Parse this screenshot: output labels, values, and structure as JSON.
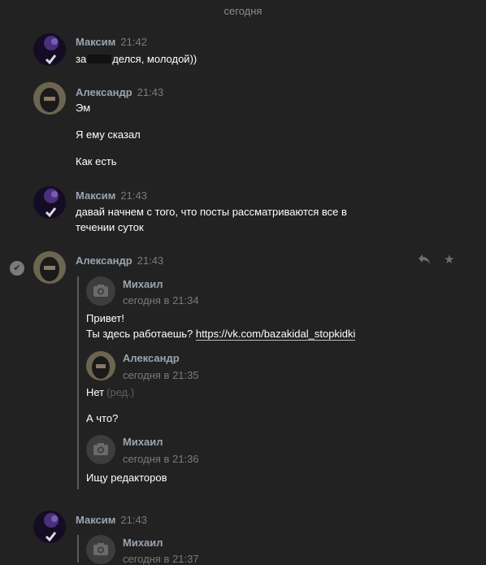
{
  "date_separator": "сегодня",
  "messages": [
    {
      "author": "Максим",
      "time": "21:42",
      "lines": [
        "за",
        "делся, молодой))"
      ]
    },
    {
      "author": "Александр",
      "time": "21:43",
      "lines": [
        "Эм",
        "Я ему сказал",
        "Как есть"
      ]
    },
    {
      "author": "Максим",
      "time": "21:43",
      "lines": [
        "давай начнем с того, что посты рассматриваются все в",
        "течении суток"
      ]
    },
    {
      "author": "Александр",
      "time": "21:43",
      "forwarded": [
        {
          "author": "Михаил",
          "date": "сегодня в 21:34",
          "lines": [
            "Привет!",
            "Ты здесь работаешь?"
          ],
          "link": "https://vk.com/bazakidal_stopkidki"
        },
        {
          "author": "Александр",
          "date": "сегодня в 21:35",
          "lines": [
            "Нет",
            "А что?"
          ],
          "edited": "(ред.)"
        },
        {
          "author": "Михаил",
          "date": "сегодня в 21:36",
          "lines": [
            "Ищу редакторов"
          ]
        }
      ]
    },
    {
      "author": "Максим",
      "time": "21:43",
      "forwarded": [
        {
          "author": "Михаил",
          "date": "сегодня в 21:37"
        }
      ]
    }
  ],
  "icons": {
    "check": "selected-check-icon",
    "reply": "reply-icon",
    "star": "star-icon",
    "camera": "camera-icon"
  },
  "colors": {
    "background": "#222222",
    "author": "#9aa5b1",
    "time": "#7a7a7a"
  }
}
